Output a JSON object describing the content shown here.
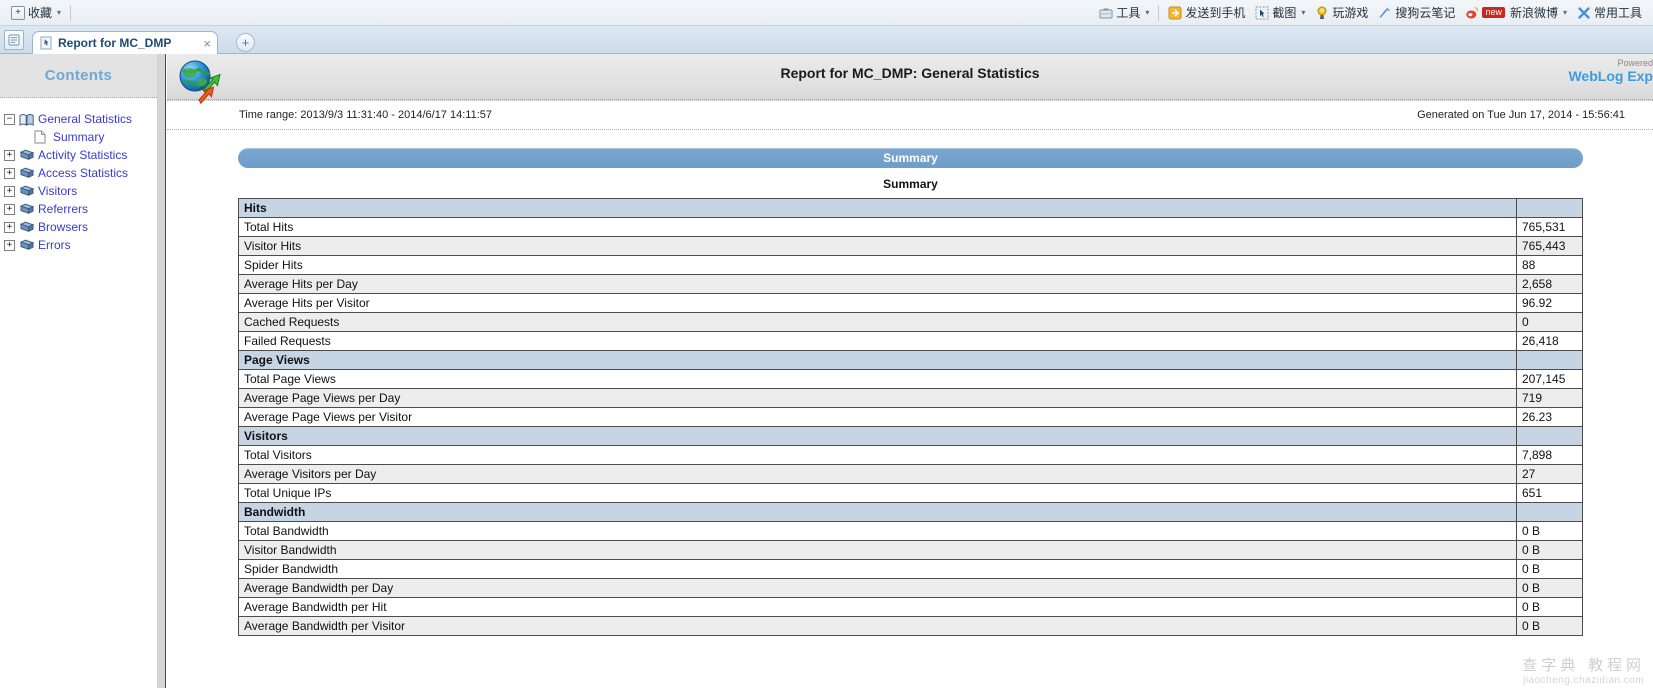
{
  "browser": {
    "favorites": {
      "label": "收藏",
      "icon": "add-favorite-icon"
    },
    "toolbar_items": [
      {
        "label": "工具",
        "icon": "tools-icon",
        "has_caret": true
      },
      {
        "label": "发送到手机",
        "icon": "send-to-phone-icon",
        "has_caret": false
      },
      {
        "label": "截图",
        "icon": "screenshot-icon",
        "has_caret": true
      },
      {
        "label": "玩游戏",
        "icon": "game-icon",
        "has_caret": false
      },
      {
        "label": "搜狗云笔记",
        "icon": "note-icon",
        "has_caret": false
      },
      {
        "label": "新浪微博",
        "icon": "weibo-icon",
        "has_caret": true,
        "badge": "new"
      },
      {
        "label": "常用工具",
        "icon": "common-tools-icon",
        "has_caret": false
      }
    ],
    "tab": {
      "title": "Report for MC_DMP",
      "close": "×",
      "icon": "page-icon"
    },
    "new_tab": "+",
    "sidebar_toggle_icon": "sidebar-panel-icon"
  },
  "contents": {
    "header": "Contents",
    "tree": [
      {
        "label": "General Statistics",
        "expander": "−",
        "icon": "open-book-icon",
        "indent": 0
      },
      {
        "label": "Summary",
        "expander": "",
        "icon": "document-icon",
        "indent": 1
      },
      {
        "label": "Activity Statistics",
        "expander": "+",
        "icon": "book-icon",
        "indent": 0
      },
      {
        "label": "Access Statistics",
        "expander": "+",
        "icon": "book-icon",
        "indent": 0
      },
      {
        "label": "Visitors",
        "expander": "+",
        "icon": "book-icon",
        "indent": 0
      },
      {
        "label": "Referrers",
        "expander": "+",
        "icon": "book-icon",
        "indent": 0
      },
      {
        "label": "Browsers",
        "expander": "+",
        "icon": "book-icon",
        "indent": 0
      },
      {
        "label": "Errors",
        "expander": "+",
        "icon": "book-icon",
        "indent": 0
      }
    ]
  },
  "report": {
    "logo_icon": "globe-arrows-icon",
    "title": "Report for MC_DMP: General Statistics",
    "powered_line1": "Powered",
    "powered_line2": "WebLog Exp",
    "time_range": "Time range: 2013/9/3 11:31:40 - 2014/6/17 14:11:57",
    "generated": "Generated on Tue Jun 17, 2014 - 15:56:41",
    "banner": "Summary",
    "subtitle": "Summary",
    "rows": [
      {
        "type": "section",
        "label": "Hits",
        "value": ""
      },
      {
        "type": "data",
        "label": "Total Hits",
        "value": "765,531"
      },
      {
        "type": "data",
        "label": "Visitor Hits",
        "value": "765,443"
      },
      {
        "type": "data",
        "label": "Spider Hits",
        "value": "88"
      },
      {
        "type": "data",
        "label": "Average Hits per Day",
        "value": "2,658"
      },
      {
        "type": "data",
        "label": "Average Hits per Visitor",
        "value": "96.92"
      },
      {
        "type": "data",
        "label": "Cached Requests",
        "value": "0"
      },
      {
        "type": "data",
        "label": "Failed Requests",
        "value": "26,418"
      },
      {
        "type": "section",
        "label": "Page Views",
        "value": ""
      },
      {
        "type": "data",
        "label": "Total Page Views",
        "value": "207,145"
      },
      {
        "type": "data",
        "label": "Average Page Views per Day",
        "value": "719"
      },
      {
        "type": "data",
        "label": "Average Page Views per Visitor",
        "value": "26.23"
      },
      {
        "type": "section",
        "label": "Visitors",
        "value": ""
      },
      {
        "type": "data",
        "label": "Total Visitors",
        "value": "7,898"
      },
      {
        "type": "data",
        "label": "Average Visitors per Day",
        "value": "27"
      },
      {
        "type": "data",
        "label": "Total Unique IPs",
        "value": "651"
      },
      {
        "type": "section",
        "label": "Bandwidth",
        "value": ""
      },
      {
        "type": "data",
        "label": "Total Bandwidth",
        "value": "0 B"
      },
      {
        "type": "data",
        "label": "Visitor Bandwidth",
        "value": "0 B"
      },
      {
        "type": "data",
        "label": "Spider Bandwidth",
        "value": "0 B"
      },
      {
        "type": "data",
        "label": "Average Bandwidth per Day",
        "value": "0 B"
      },
      {
        "type": "data",
        "label": "Average Bandwidth per Hit",
        "value": "0 B"
      },
      {
        "type": "data",
        "label": "Average Bandwidth per Visitor",
        "value": "0 B"
      }
    ]
  },
  "watermark": {
    "line1": "查字典  教程网",
    "line2": "jiaocheng.chazidian.com"
  },
  "colors": {
    "accent_blue": "#6e9dc9",
    "section_header": "#c6d4e4",
    "link_blue": "#3a3ad0",
    "contents_title": "#6fa8d6",
    "powered_blue": "#3d9be0"
  }
}
